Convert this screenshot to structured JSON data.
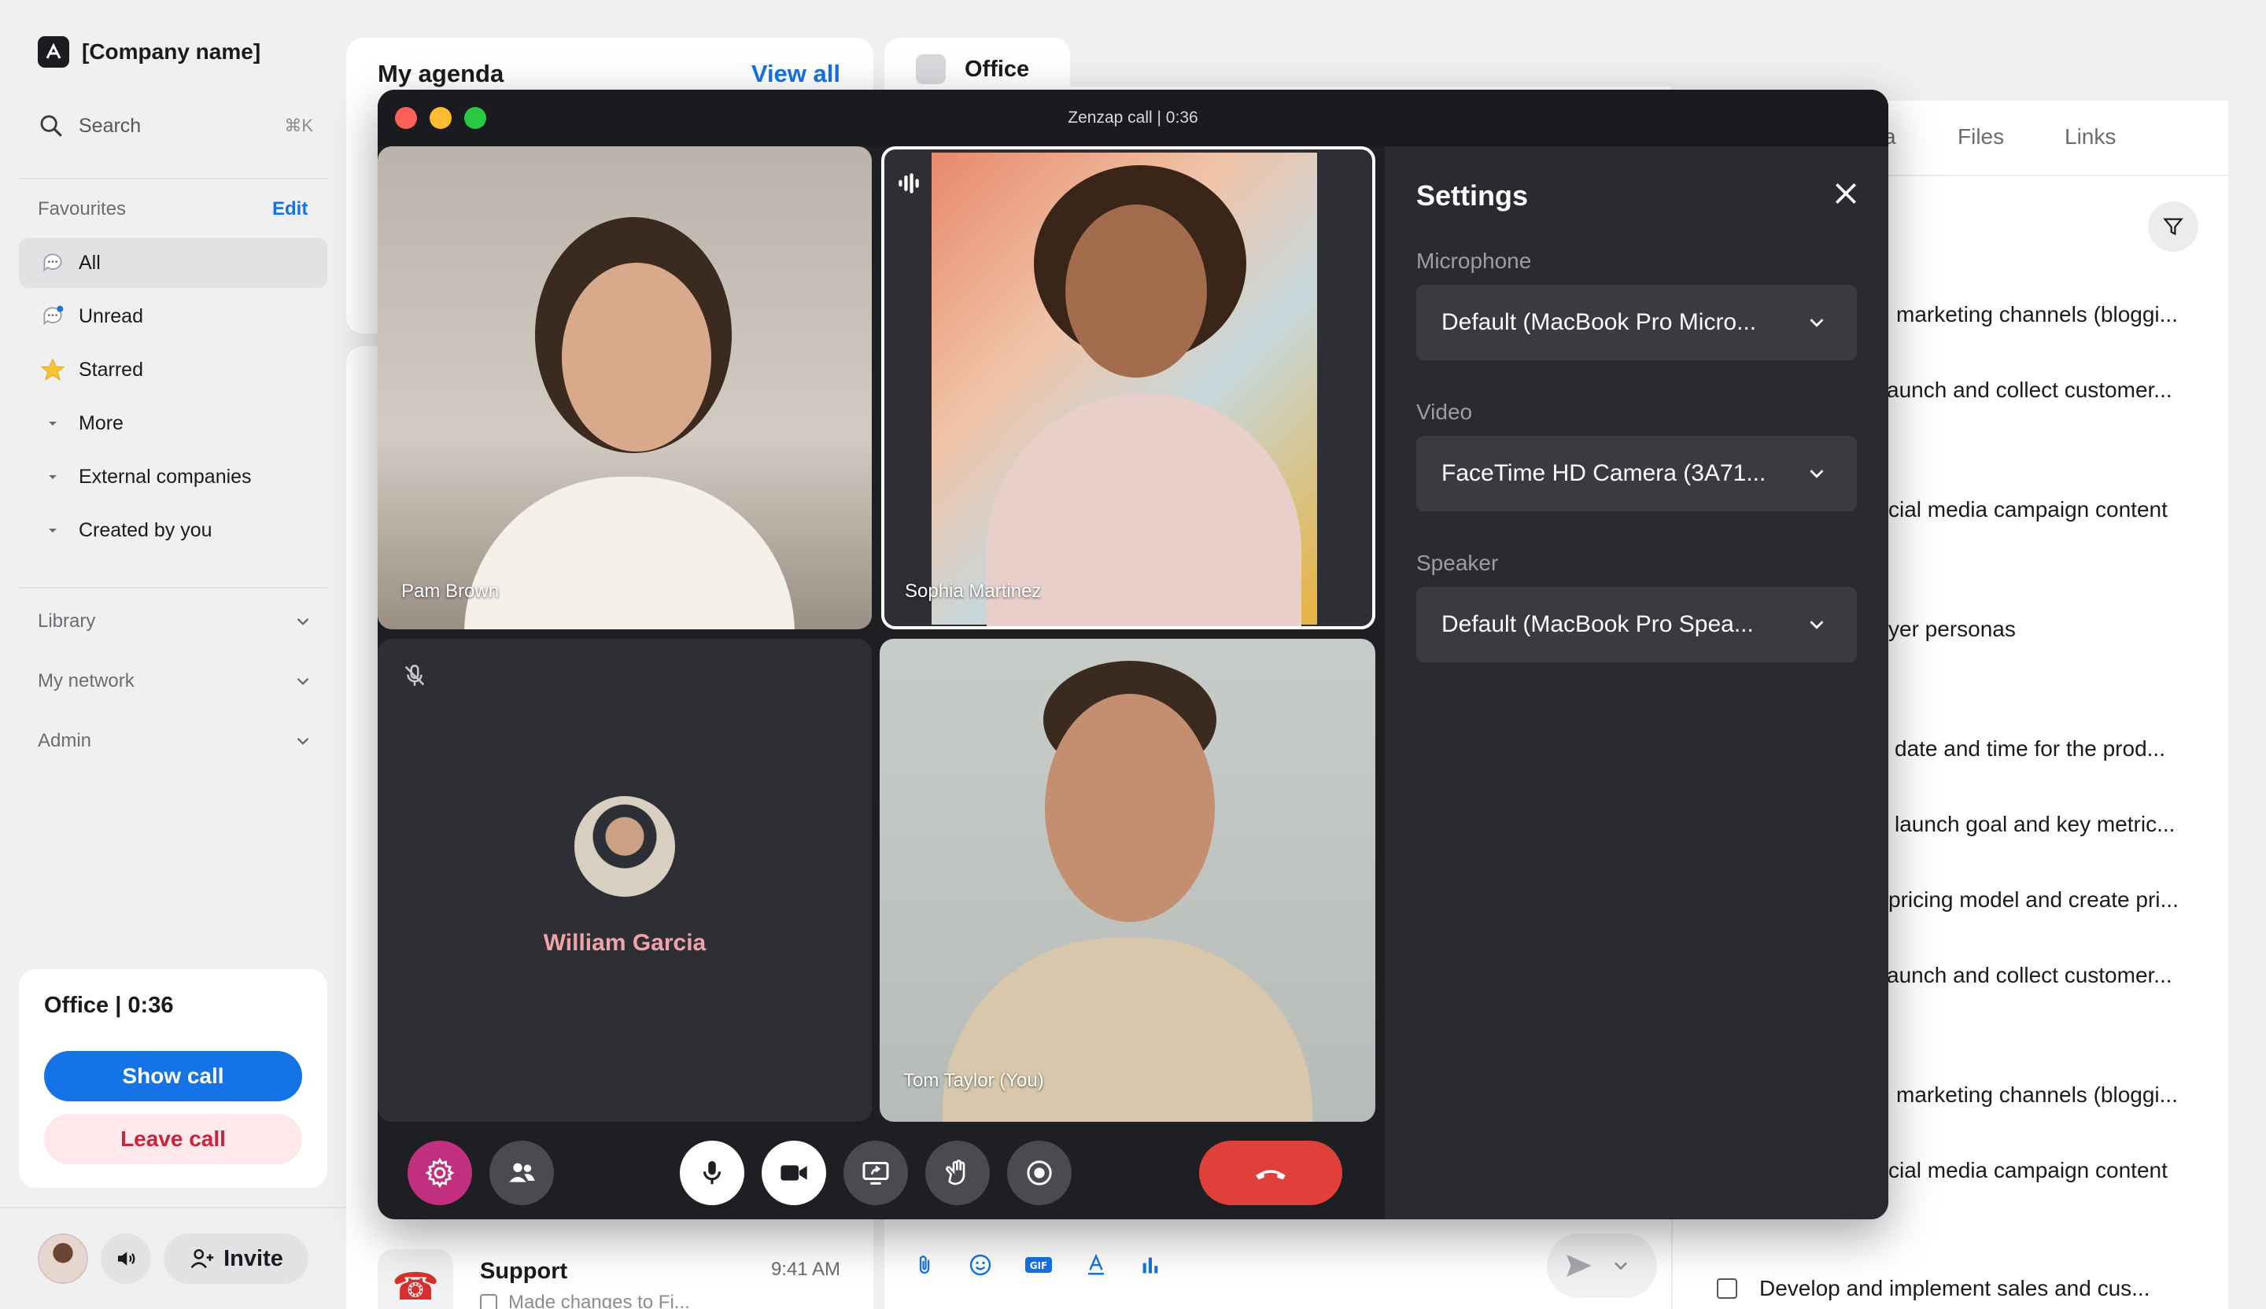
{
  "sidebar": {
    "company": "[Company name]",
    "search": {
      "label": "Search",
      "shortcut": "⌘K"
    },
    "favourites": {
      "label": "Favourites",
      "edit": "Edit"
    },
    "items": [
      {
        "label": "All"
      },
      {
        "label": "Unread"
      },
      {
        "label": "Starred"
      },
      {
        "label": "More"
      },
      {
        "label": "External companies"
      },
      {
        "label": "Created by you"
      }
    ],
    "groups": [
      {
        "label": "Library"
      },
      {
        "label": "My network"
      },
      {
        "label": "Admin"
      }
    ],
    "call_card": {
      "title": "Office | 0:36",
      "show": "Show call",
      "leave": "Leave call"
    },
    "invite": "Invite"
  },
  "agenda": {
    "title": "My agenda",
    "view_all": "View all"
  },
  "chat_list": {
    "support": {
      "name": "Support",
      "time": "9:41 AM",
      "preview": "Made changes to Fi..."
    }
  },
  "office_tab": {
    "title": "Office"
  },
  "tasks": {
    "tabs": [
      "a",
      "Files",
      "Links"
    ],
    "items": [
      "marketing channels (bloggi...",
      "aunch and collect customer...",
      "cial media campaign content",
      "yer personas",
      "date and time for the prod...",
      "launch goal and key metric...",
      "pricing model and create pri...",
      "aunch and collect customer...",
      "marketing channels (bloggi...",
      "cial media campaign content"
    ],
    "last_item": "Develop and implement sales and cus..."
  },
  "call": {
    "window_title": "Zenzap call | 0:36",
    "participants": [
      {
        "name": "Pam Brown"
      },
      {
        "name": "Sophia Martinez"
      },
      {
        "name": "William Garcia"
      },
      {
        "name": "Tom Taylor (You)"
      }
    ],
    "settings": {
      "title": "Settings",
      "microphone": {
        "label": "Microphone",
        "value": "Default (MacBook Pro Micro..."
      },
      "video": {
        "label": "Video",
        "value": "FaceTime HD Camera (3A71..."
      },
      "speaker": {
        "label": "Speaker",
        "value": "Default (MacBook Pro Spea..."
      }
    }
  },
  "colors": {
    "accent": "#1473e6",
    "danger": "#e03f3a",
    "call_bg": "#1e1f23",
    "settings_bg": "#2a2b30",
    "william_name": "#f0a3a8",
    "settings_active": "#c0307f"
  }
}
